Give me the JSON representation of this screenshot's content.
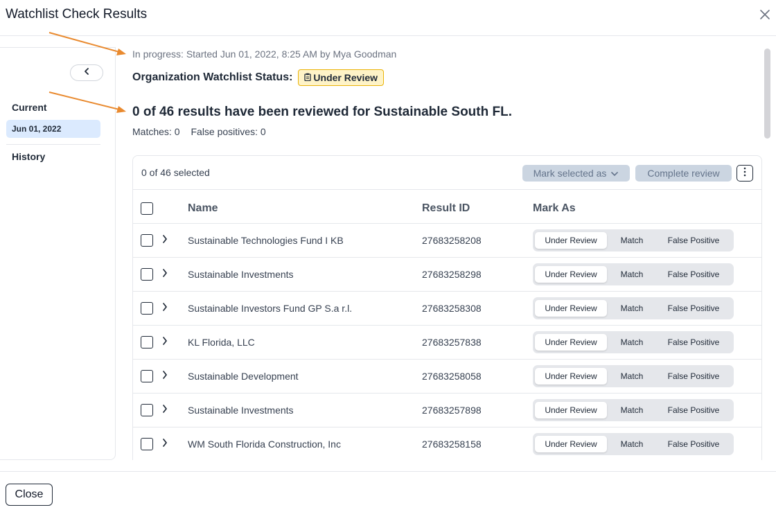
{
  "dialog": {
    "title": "Watchlist Check Results",
    "close_icon": "close-icon"
  },
  "sidebar": {
    "collapse_icon": "chevron-left-icon",
    "current_label": "Current",
    "current_date": "Jun 01, 2022",
    "history_label": "History"
  },
  "main": {
    "progress_text": "In progress: Started Jun 01, 2022, 8:25 AM by Mya Goodman",
    "status_label": "Organization Watchlist Status:",
    "status_badge": "Under Review",
    "status_badge_icon": "clipboard-icon",
    "results_heading": "0 of 46 results have been reviewed for Sustainable South FL.",
    "matches": "Matches: 0",
    "false_positives": "False positives: 0"
  },
  "table": {
    "selected_count": "0 of 46 selected",
    "mark_selected_label": "Mark selected as",
    "complete_review_label": "Complete review",
    "more_icon": "more-vertical-icon",
    "headers": {
      "name": "Name",
      "result_id": "Result ID",
      "mark_as": "Mark As"
    },
    "mark_options": [
      "Under Review",
      "Match",
      "False Positive"
    ],
    "rows": [
      {
        "name": "Sustainable Technologies Fund I KB",
        "result_id": "27683258208",
        "mark": "Under Review"
      },
      {
        "name": "Sustainable Investments",
        "result_id": "27683258298",
        "mark": "Under Review"
      },
      {
        "name": "Sustainable Investors Fund GP S.a r.l.",
        "result_id": "27683258308",
        "mark": "Under Review"
      },
      {
        "name": "KL Florida, LLC",
        "result_id": "27683257838",
        "mark": "Under Review"
      },
      {
        "name": "Sustainable Development",
        "result_id": "27683258058",
        "mark": "Under Review"
      },
      {
        "name": "Sustainable Investments",
        "result_id": "27683257898",
        "mark": "Under Review"
      },
      {
        "name": "WM South Florida Construction, Inc",
        "result_id": "27683258158",
        "mark": "Under Review"
      }
    ]
  },
  "footer": {
    "close_label": "Close"
  },
  "colors": {
    "annotation_arrow": "#e98a2f",
    "badge_bg": "#fef3c7",
    "selected_date_bg": "#dbeafe"
  }
}
